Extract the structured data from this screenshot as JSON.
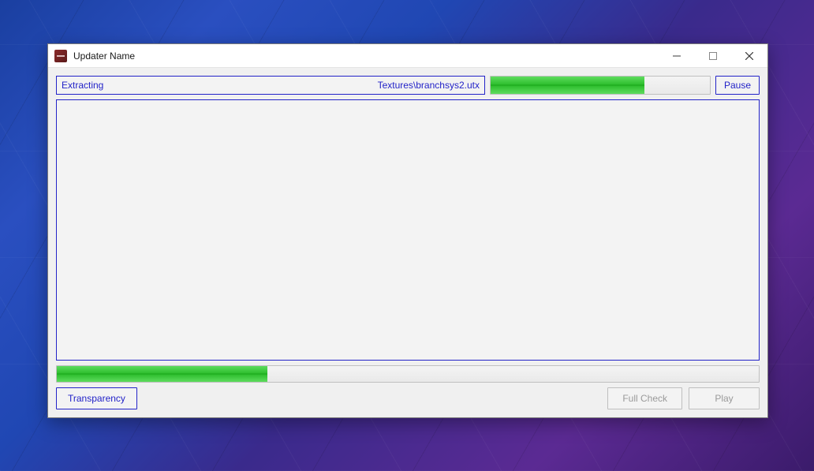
{
  "window": {
    "title": "Updater Name"
  },
  "status": {
    "action": "Extracting",
    "file": "Textures\\branchsys2.utx"
  },
  "progress": {
    "file_percent": 70,
    "overall_percent": 30
  },
  "buttons": {
    "pause": "Pause",
    "transparency": "Transparency",
    "full_check": "Full Check",
    "play": "Play"
  },
  "colors": {
    "accent": "#2323c8",
    "progress_fill": "#2fbf2f"
  }
}
